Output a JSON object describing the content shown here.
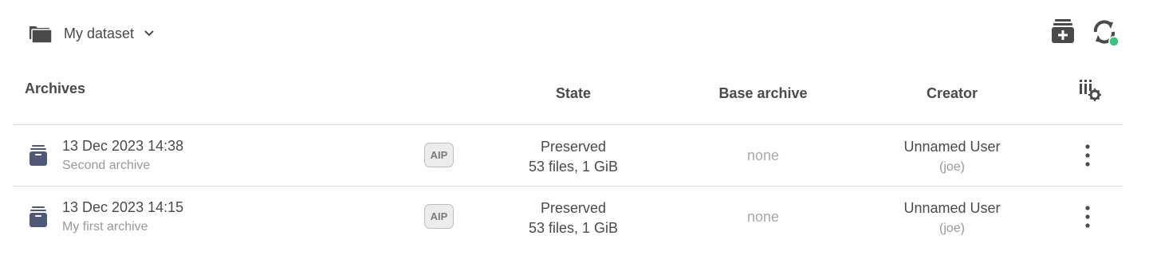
{
  "header": {
    "dataset_name": "My dataset",
    "icons": {
      "folder": "folder-stack-icon",
      "dropdown": "chevron-down-icon",
      "add": "add-archive-icon",
      "sync": "sync-icon"
    },
    "sync_status_color": "#3cc27a"
  },
  "table": {
    "columns": {
      "archives": "Archives",
      "state": "State",
      "base_archive": "Base archive",
      "creator": "Creator"
    },
    "column_settings_icon": "column-settings-icon",
    "rows": [
      {
        "date": "13 Dec 2023 14:38",
        "description": "Second archive",
        "badge": "AIP",
        "state": "Preserved",
        "stats": "53 files, 1 GiB",
        "base_archive": "none",
        "creator_name": "Unnamed User",
        "creator_login": "(joe)"
      },
      {
        "date": "13 Dec 2023 14:15",
        "description": "My first archive",
        "badge": "AIP",
        "state": "Preserved",
        "stats": "53 files, 1 GiB",
        "base_archive": "none",
        "creator_name": "Unnamed User",
        "creator_login": "(joe)"
      }
    ]
  },
  "colors": {
    "icon": "#4a4a4a",
    "archive_icon": "#4f5877",
    "divider": "#dddddd"
  }
}
